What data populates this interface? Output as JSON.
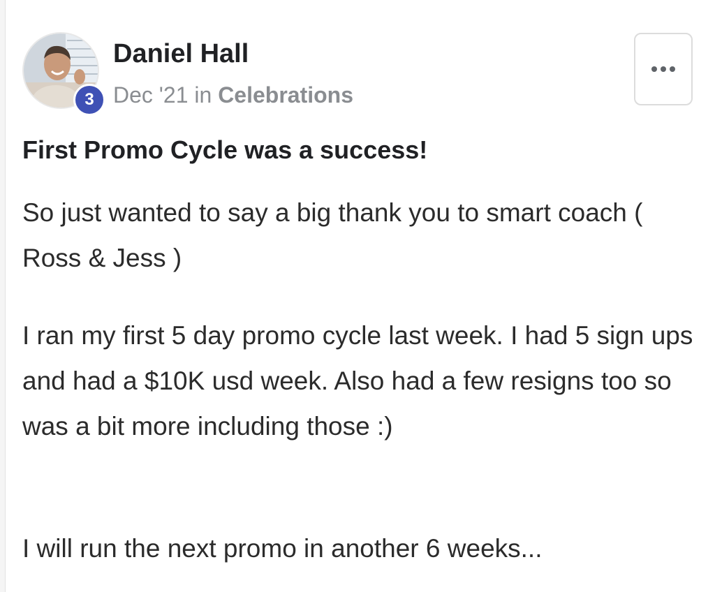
{
  "post": {
    "author": "Daniel Hall",
    "level_badge": "3",
    "date": "Dec '21",
    "in_word": "in",
    "category": "Celebrations",
    "title": "First Promo Cycle was a success!",
    "paragraphs": [
      "So just wanted to say a big thank you to smart coach ( Ross & Jess )",
      "I ran my first 5 day promo cycle last week. I had 5 sign ups and had a $10K usd week. Also had a few resigns too so was a bit more including those :)",
      "I will run the next promo in another 6 weeks..."
    ]
  },
  "icons": {
    "more": "more-horizontal-icon"
  },
  "colors": {
    "badge": "#3f51b5",
    "meta_text": "#8a8d91"
  }
}
